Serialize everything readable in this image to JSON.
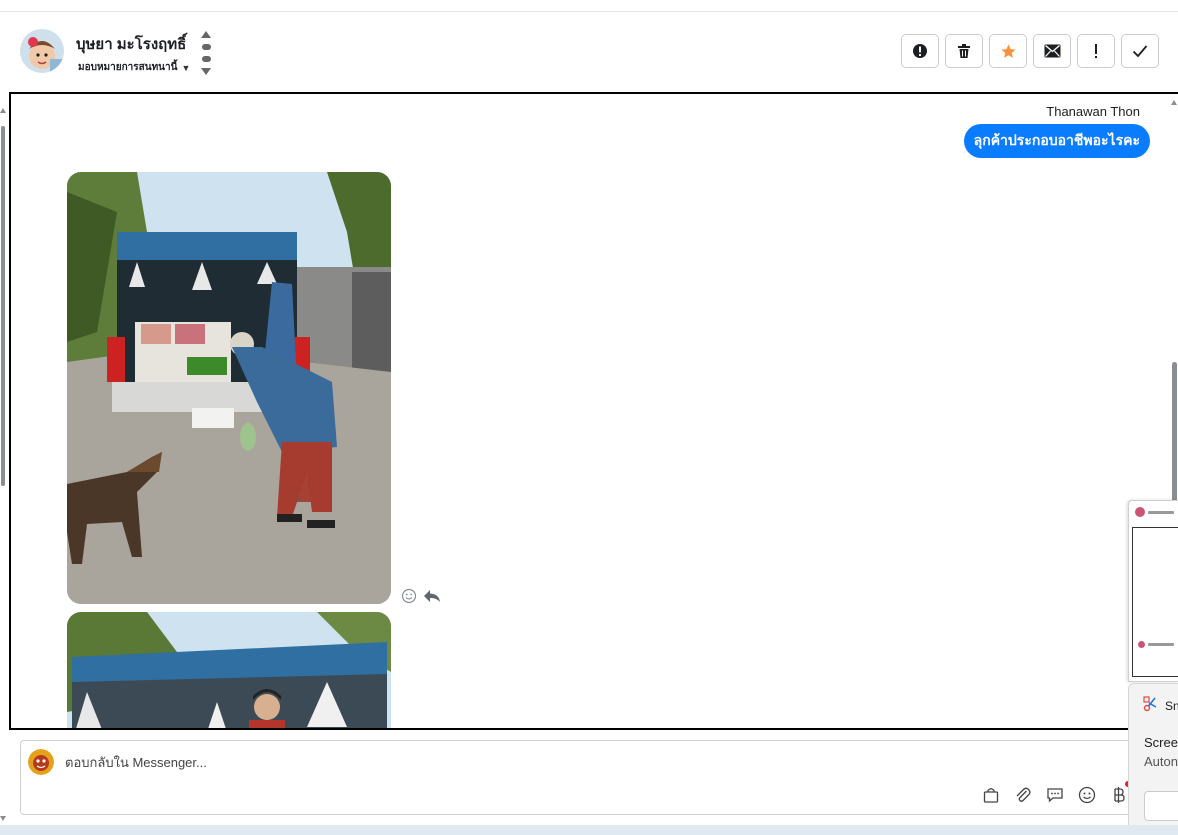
{
  "header": {
    "contact_name": "บุษยา มะโรงฤทธิ์",
    "assign_label": "มอบหมายการสนทนานี้",
    "actions": [
      {
        "name": "report-button",
        "icon": "alert-circle-icon"
      },
      {
        "name": "delete-button",
        "icon": "trash-icon"
      },
      {
        "name": "star-button",
        "icon": "star-icon"
      },
      {
        "name": "mark-unread-button",
        "icon": "envelope-icon"
      },
      {
        "name": "spam-button",
        "icon": "exclamation-icon"
      },
      {
        "name": "done-button",
        "icon": "check-icon"
      }
    ],
    "star_color": "#f7923b"
  },
  "conversation": {
    "sender_name": "Thanawan Thon",
    "outgoing_message": "ลุกค้าประกอบอาชีพอะไรคะ",
    "bubble_color": "#0a7cff",
    "attachments": [
      {
        "type": "photo",
        "icon": "photo-vendor-truck"
      },
      {
        "type": "photo",
        "icon": "photo-vendor-truck-front"
      }
    ],
    "reaction_icons": [
      "emoji-icon",
      "reply-icon"
    ]
  },
  "composer": {
    "placeholder": "ตอบกลับใน Messenger...",
    "tools": [
      "bag-icon",
      "paperclip-icon",
      "chat-bubble-icon",
      "emoji-icon",
      "baht-icon"
    ]
  },
  "toast": {
    "app_name": "Sn",
    "title": "Scree",
    "subtitle": "Auton"
  }
}
